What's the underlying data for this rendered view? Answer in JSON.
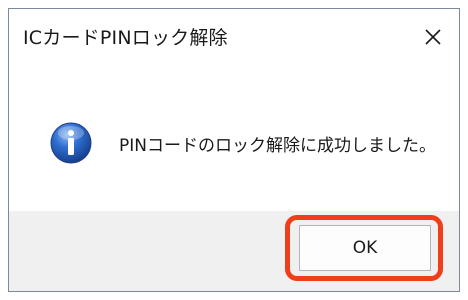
{
  "dialog": {
    "title": "ICカードPINロック解除",
    "close_icon": "close-icon",
    "message_icon": "info-icon",
    "message": "PINコードのロック解除に成功しました。",
    "ok_label": "OK",
    "highlight_color": "#ee3e1a"
  }
}
